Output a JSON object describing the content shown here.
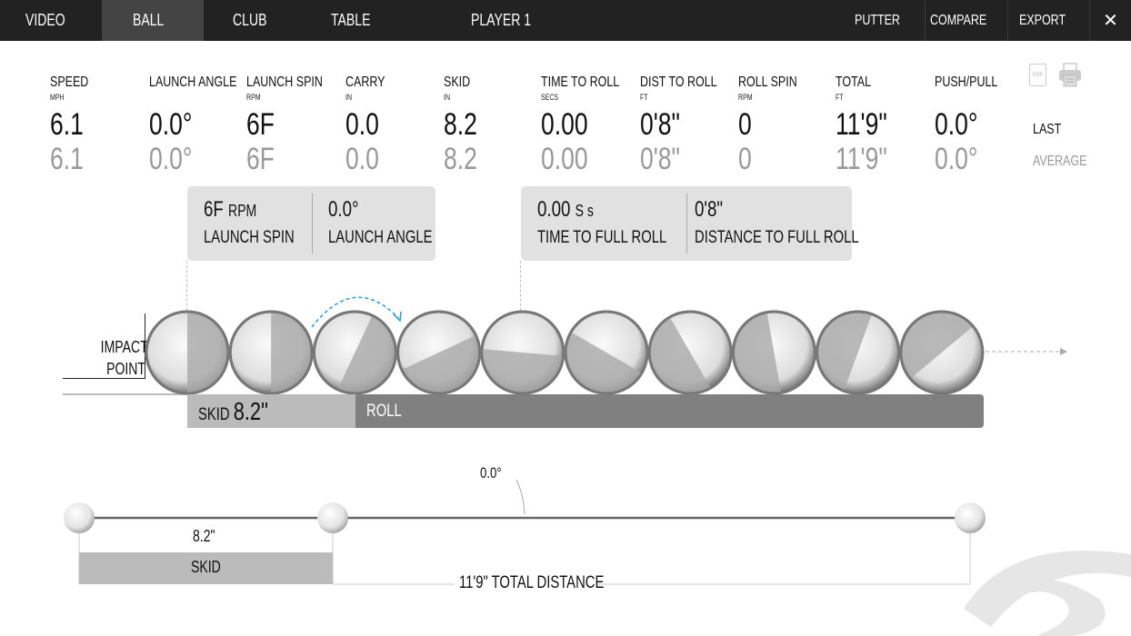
{
  "nav": {
    "tabs": [
      "VIDEO",
      "BALL",
      "CLUB",
      "TABLE",
      "PLAYER 1"
    ],
    "active": "BALL",
    "right": [
      "PUTTER",
      "COMPARE",
      "EXPORT"
    ]
  },
  "metrics": [
    {
      "label": "SPEED",
      "unit": "MPH",
      "last": "6.1",
      "avg": "6.1"
    },
    {
      "label": "LAUNCH ANGLE",
      "unit": "",
      "last": "0.0°",
      "avg": "0.0°"
    },
    {
      "label": "LAUNCH SPIN",
      "unit": "RPM",
      "last": "6F",
      "avg": "6F"
    },
    {
      "label": "CARRY",
      "unit": "IN",
      "last": "0.0",
      "avg": "0.0"
    },
    {
      "label": "SKID",
      "unit": "IN",
      "last": "8.2",
      "avg": "8.2"
    },
    {
      "label": "TIME TO ROLL",
      "unit": "SECS",
      "last": "0.00",
      "avg": "0.00"
    },
    {
      "label": "DIST TO ROLL",
      "unit": "FT",
      "last": "0'8\"",
      "avg": "0'8\""
    },
    {
      "label": "ROLL SPIN",
      "unit": "RPM",
      "last": "0",
      "avg": "0"
    },
    {
      "label": "TOTAL",
      "unit": "FT",
      "last": "11'9\"",
      "avg": "11'9\""
    },
    {
      "label": "PUSH/PULL",
      "unit": "",
      "last": "0.0°",
      "avg": "0.0°"
    }
  ],
  "row_labels": {
    "last": "LAST",
    "average": "AVERAGE"
  },
  "export_icons": {
    "pdf": "PDF",
    "print": "printer-icon"
  },
  "launch_box": {
    "spin_value": "6F",
    "spin_unit": "RPM",
    "spin_label": "LAUNCH SPIN",
    "angle_value": "0.0°",
    "angle_label": "LAUNCH ANGLE"
  },
  "roll_box": {
    "time_value": "0.00",
    "time_unit": "S s",
    "time_label": "TIME TO FULL ROLL",
    "dist_value": "0'8\"",
    "dist_label": "DISTANCE TO FULL ROLL"
  },
  "impact": {
    "line1": "IMPACT",
    "line2": "POINT"
  },
  "phases": {
    "skid_label": "SKID",
    "skid_value": "8.2\"",
    "roll_label": "ROLL"
  },
  "top_view": {
    "angle": "0.0°",
    "skid_value": "8.2\"",
    "skid_label": "SKID",
    "total": "11'9\" TOTAL DISTANCE"
  },
  "colors": {
    "nav_bg": "#222222",
    "nav_active": "#444444",
    "skid_bar": "#bbbbbb",
    "roll_bar": "#808080",
    "spin_arrow": "#2a9ad6"
  }
}
